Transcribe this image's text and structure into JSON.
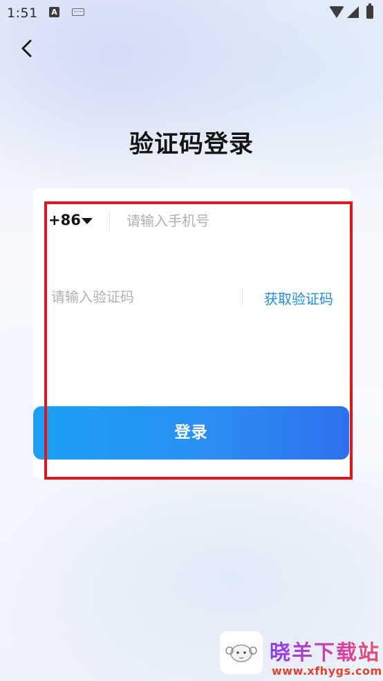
{
  "status_bar": {
    "time": "1:51",
    "icons": [
      "notification-a-icon",
      "keyboard-icon",
      "wifi-icon",
      "signal-icon",
      "battery-icon"
    ]
  },
  "header": {
    "back_icon": "chevron-left-icon",
    "title": "验证码登录"
  },
  "form": {
    "country_code": "+86",
    "country_dropdown_icon": "caret-down-icon",
    "phone_placeholder": "请输入手机号",
    "code_placeholder": "请输入验证码",
    "get_code_label": "获取验证码",
    "submit_label": "登录"
  },
  "watermark": {
    "site_name": "晓羊下载站",
    "site_url": "www.xfhygs.com"
  },
  "colors": {
    "accent_link": "#1c8ee9",
    "button_gradient_start": "#1aa0f5",
    "button_gradient_end": "#2f6ff0",
    "highlight_box": "#e4141d"
  }
}
